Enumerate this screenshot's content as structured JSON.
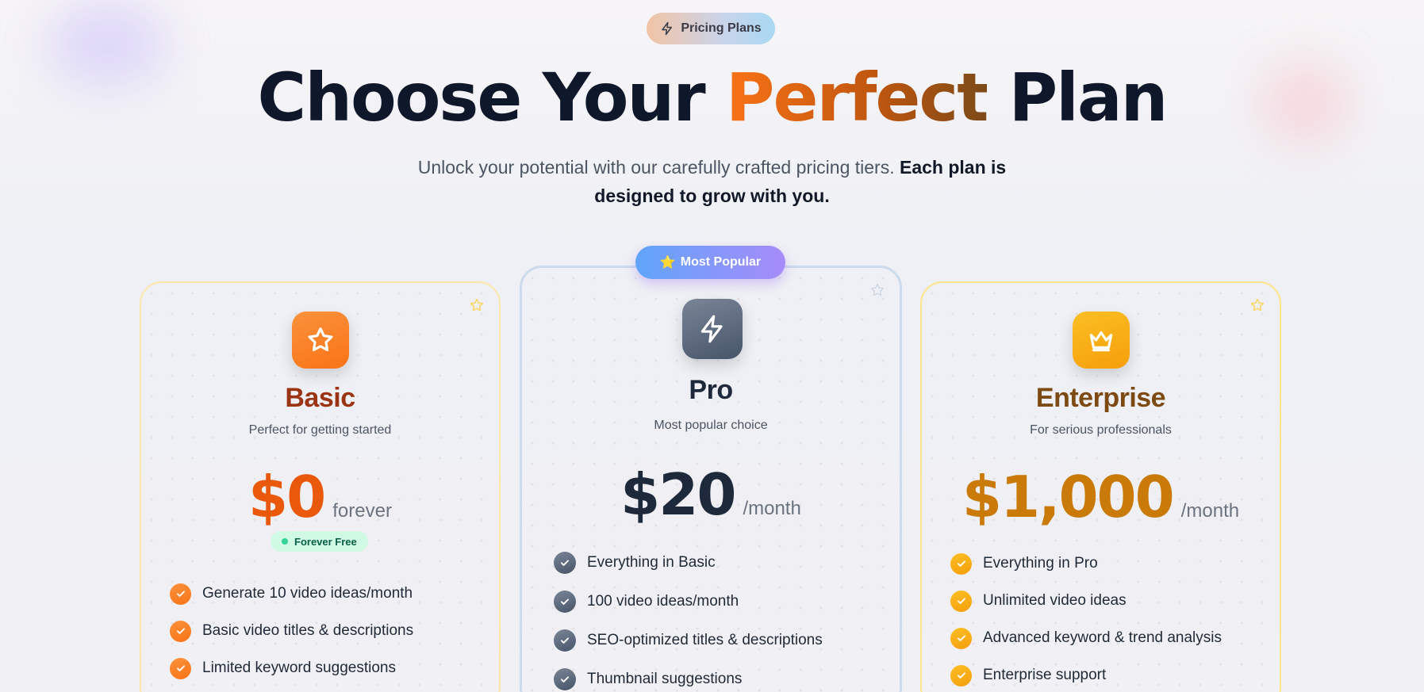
{
  "header": {
    "badge_icon": "lightning-icon",
    "badge_label": "Pricing Plans",
    "title_start": "Choose Your ",
    "title_accent": "Perfect",
    "title_end": " Plan",
    "subtitle_plain": "Unlock your potential with our carefully crafted pricing tiers. ",
    "subtitle_bold": "Each plan is designed to grow with you."
  },
  "popular_badge": {
    "icon": "star-emoji-icon",
    "emoji": "⭐",
    "label": "Most Popular"
  },
  "plans": [
    {
      "id": "basic",
      "icon": "star-icon",
      "name": "Basic",
      "tagline": "Perfect for getting started",
      "price": "$0",
      "period": "forever",
      "pill": "Forever Free",
      "features": [
        "Generate 10 video ideas/month",
        "Basic video titles & descriptions",
        "Limited keyword suggestions"
      ]
    },
    {
      "id": "pro",
      "icon": "lightning-icon",
      "name": "Pro",
      "tagline": "Most popular choice",
      "price": "$20",
      "period": "/month",
      "features": [
        "Everything in Basic",
        "100 video ideas/month",
        "SEO-optimized titles & descriptions",
        "Thumbnail suggestions"
      ]
    },
    {
      "id": "enterprise",
      "icon": "crown-icon",
      "name": "Enterprise",
      "tagline": "For serious professionals",
      "price": "$1,000",
      "period": "/month",
      "features": [
        "Everything in Pro",
        "Unlimited video ideas",
        "Advanced keyword & trend analysis",
        "Enterprise support"
      ]
    }
  ],
  "colors": {
    "basic_accent": "#f97316",
    "pro_accent": "#475569",
    "enterprise_accent": "#f59e0b",
    "popular_gradient_start": "#60a5fa",
    "popular_gradient_end": "#a78bfa"
  }
}
